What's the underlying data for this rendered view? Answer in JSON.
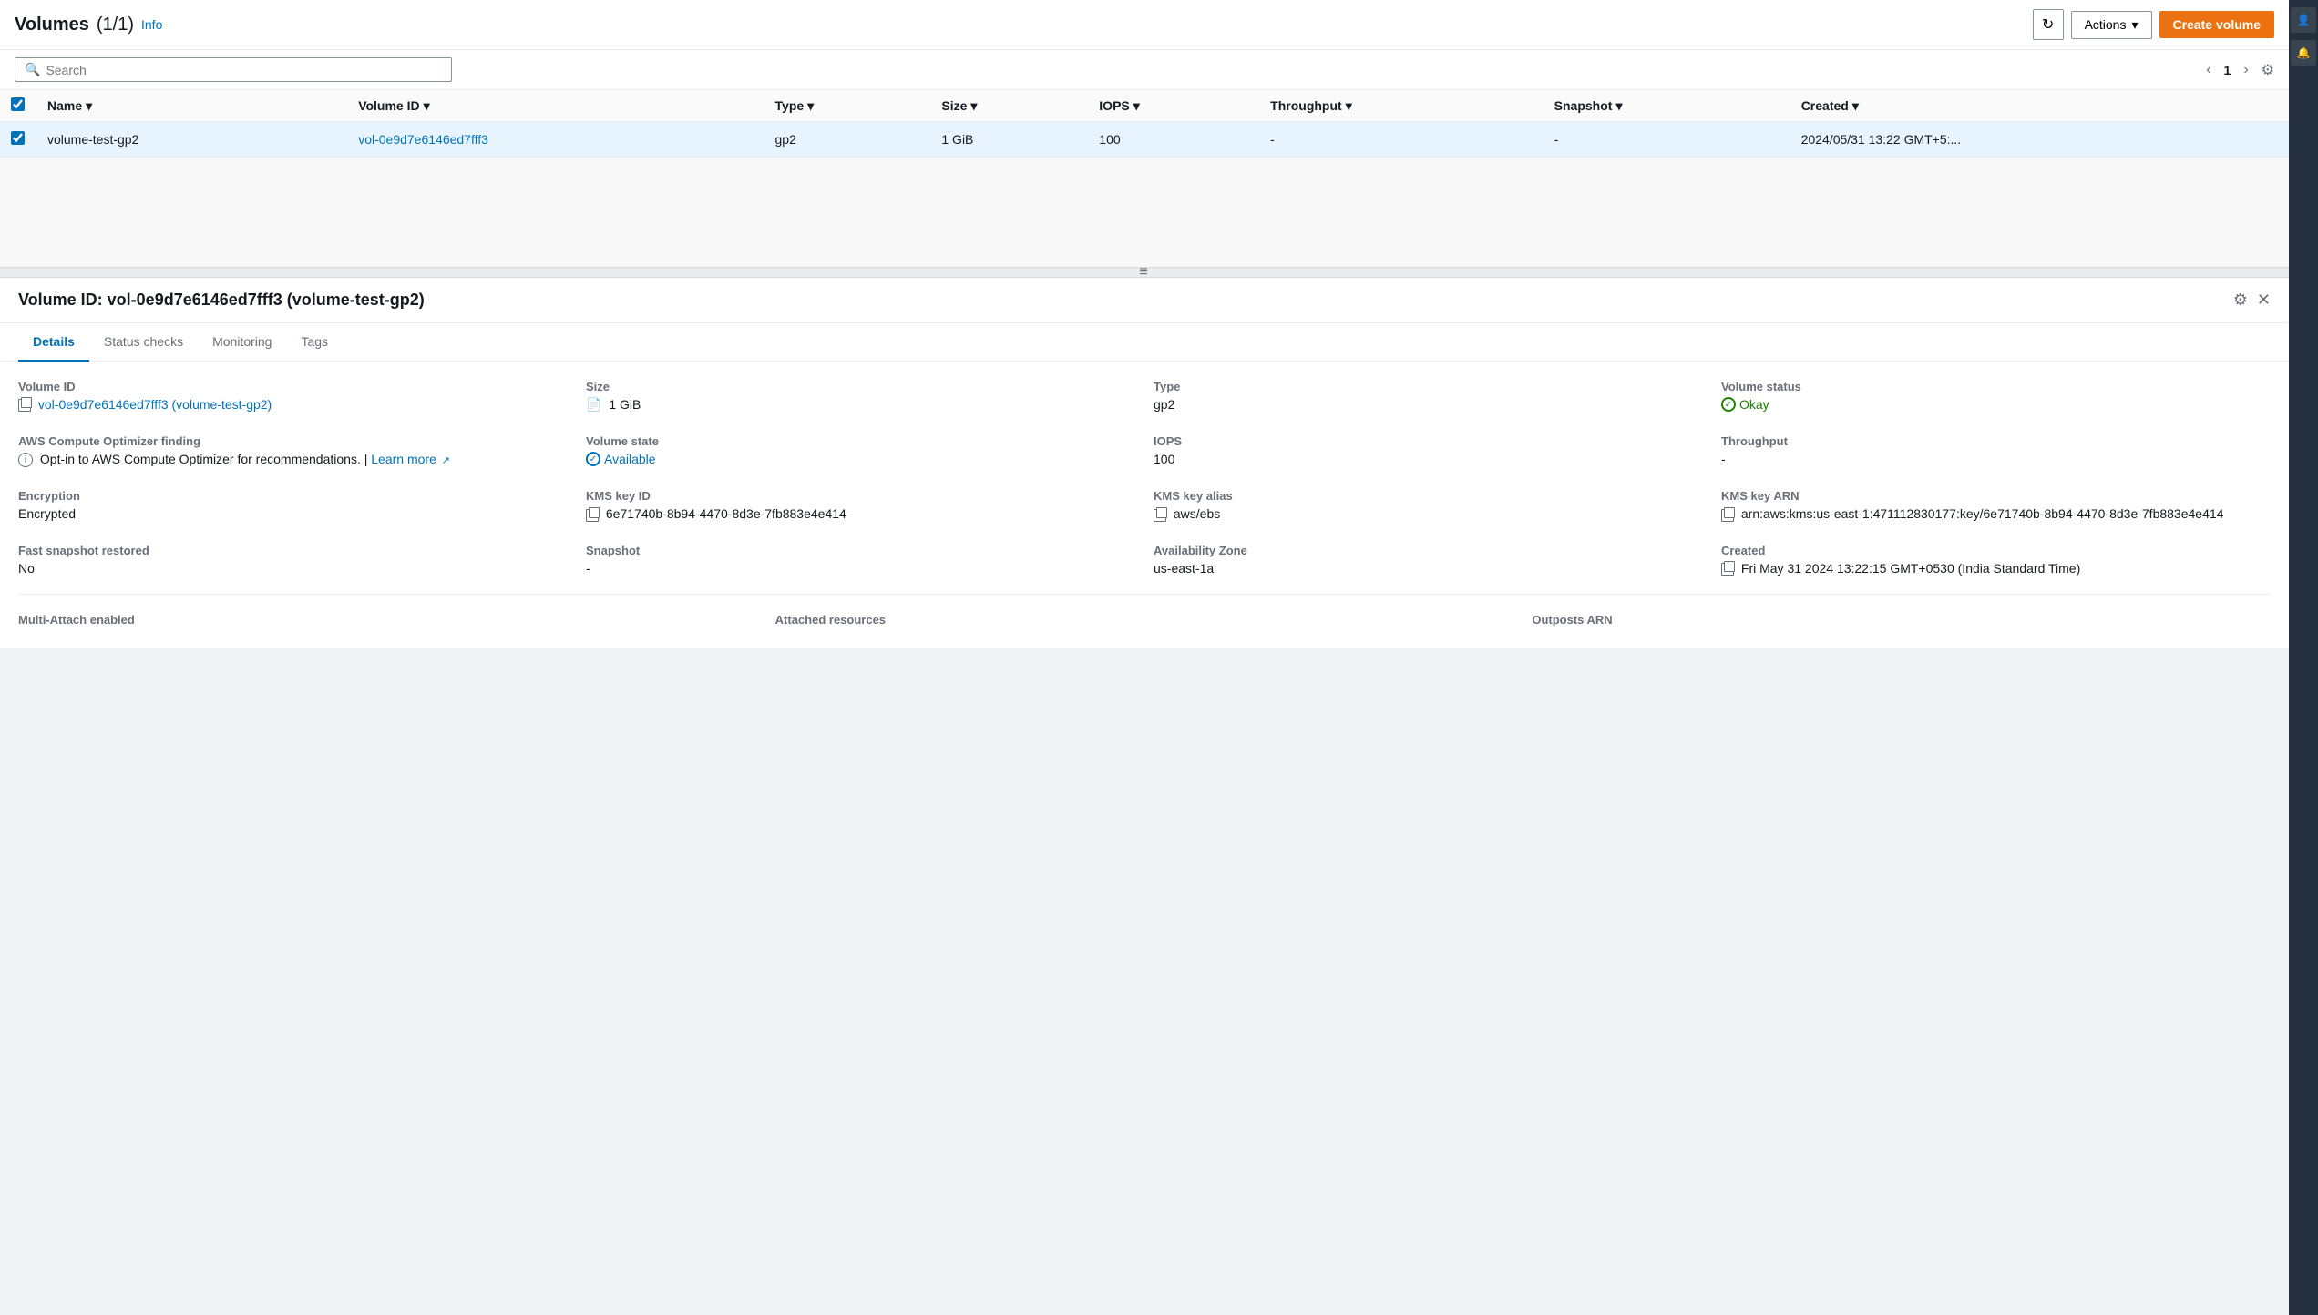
{
  "header": {
    "title": "Volumes",
    "count": "(1/1)",
    "info_label": "Info",
    "refresh_icon": "↻",
    "actions_label": "Actions",
    "create_button": "Create volume"
  },
  "search": {
    "placeholder": "Search"
  },
  "pagination": {
    "current": "1",
    "prev_icon": "‹",
    "next_icon": "›",
    "settings_icon": "⚙"
  },
  "table": {
    "columns": [
      "Name",
      "Volume ID",
      "Type",
      "Size",
      "IOPS",
      "Throughput",
      "Snapshot",
      "Created"
    ],
    "rows": [
      {
        "name": "volume-test-gp2",
        "volume_id": "vol-0e9d7e6146ed7fff3",
        "type": "gp2",
        "size": "1 GiB",
        "iops": "100",
        "throughput": "-",
        "snapshot": "-",
        "created": "2024/05/31 13:22 GMT+5:..."
      }
    ]
  },
  "resize_icon": "≡",
  "detail": {
    "title": "Volume ID: vol-0e9d7e6146ed7fff3 (volume-test-gp2)",
    "tabs": [
      "Details",
      "Status checks",
      "Monitoring",
      "Tags"
    ],
    "active_tab": "Details",
    "fields": {
      "volume_id_label": "Volume ID",
      "volume_id_value": "vol-0e9d7e6146ed7fff3 (volume-test-gp2)",
      "size_label": "Size",
      "size_value": "1 GiB",
      "type_label": "Type",
      "type_value": "gp2",
      "volume_status_label": "Volume status",
      "volume_status_value": "Okay",
      "aws_optimizer_label": "AWS Compute Optimizer finding",
      "aws_optimizer_desc": "Opt-in to AWS Compute Optimizer for recommendations.",
      "learn_more": "Learn more",
      "volume_state_label": "Volume state",
      "volume_state_value": "Available",
      "iops_label": "IOPS",
      "iops_value": "100",
      "throughput_label": "Throughput",
      "throughput_value": "-",
      "encryption_label": "Encryption",
      "encryption_value": "Encrypted",
      "kms_key_id_label": "KMS key ID",
      "kms_key_id_value": "6e71740b-8b94-4470-8d3e-7fb883e4e414",
      "kms_key_alias_label": "KMS key alias",
      "kms_key_alias_value": "aws/ebs",
      "kms_key_arn_label": "KMS key ARN",
      "kms_key_arn_value": "arn:aws:kms:us-east-1:471112830177:key/6e71740b-8b94-4470-8d3e-7fb883e4e414",
      "fast_snapshot_label": "Fast snapshot restored",
      "fast_snapshot_value": "No",
      "snapshot_label": "Snapshot",
      "snapshot_value": "-",
      "availability_zone_label": "Availability Zone",
      "availability_zone_value": "us-east-1a",
      "created_label": "Created",
      "created_value": "Fri May 31 2024 13:22:15 GMT+0530 (India Standard Time)",
      "multi_attach_label": "Multi-Attach enabled",
      "attached_resources_label": "Attached resources",
      "outposts_arn_label": "Outposts ARN"
    }
  }
}
